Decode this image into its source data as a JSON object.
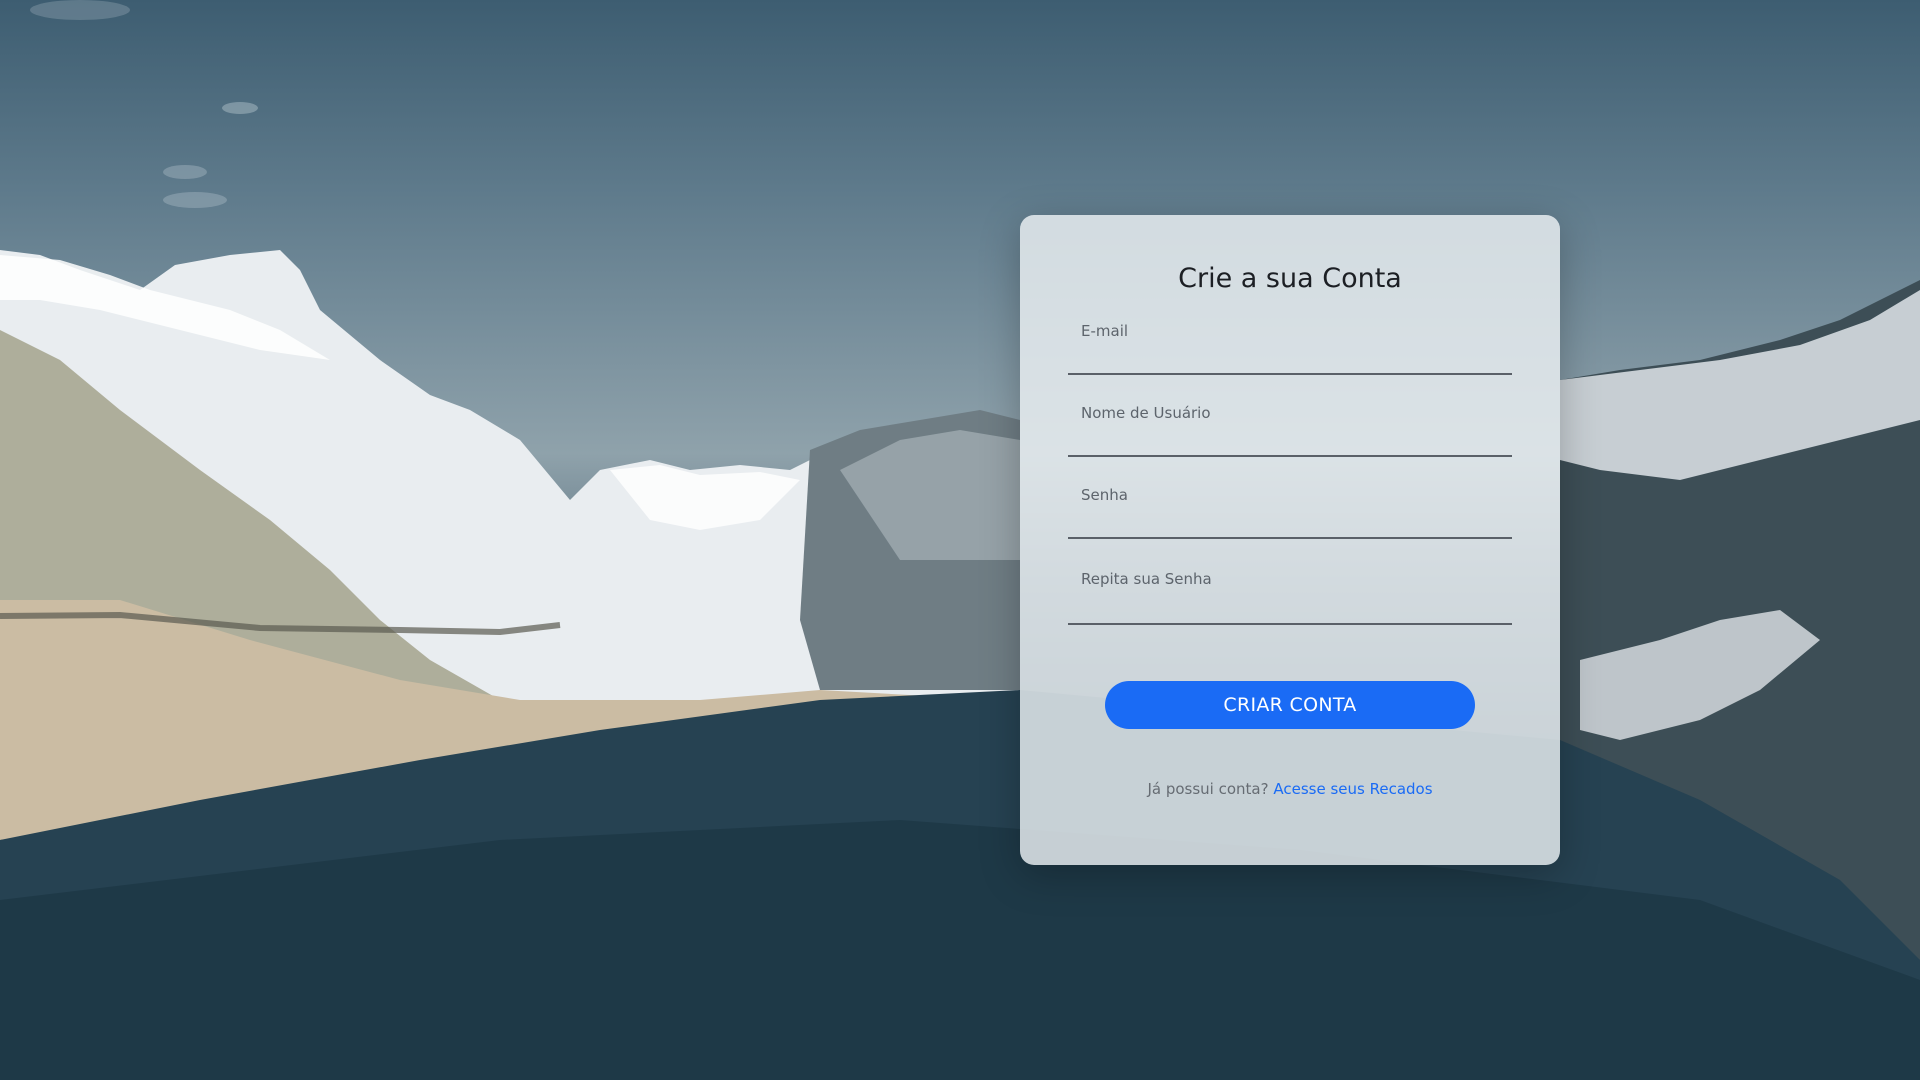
{
  "background": {
    "description_colors": {
      "sky_top": "#3d5d71",
      "sky_mid": "#8fa2ab",
      "water": "#1b3441",
      "snow": "#eef1f3",
      "shore": "#cbbca3"
    }
  },
  "form": {
    "title": "Crie a sua Conta",
    "fields": {
      "email_placeholder": "E-mail",
      "username_placeholder": "Nome de Usuário",
      "password_placeholder": "Senha",
      "repeat_password_placeholder": "Repita sua Senha"
    },
    "submit_label": "CRIAR CONTA",
    "footer": {
      "prompt": "Já possui conta?",
      "link_label": "Acesse seus Recados"
    },
    "colors": {
      "accent": "#1a6bf5",
      "card": "#ecf0f3"
    }
  }
}
